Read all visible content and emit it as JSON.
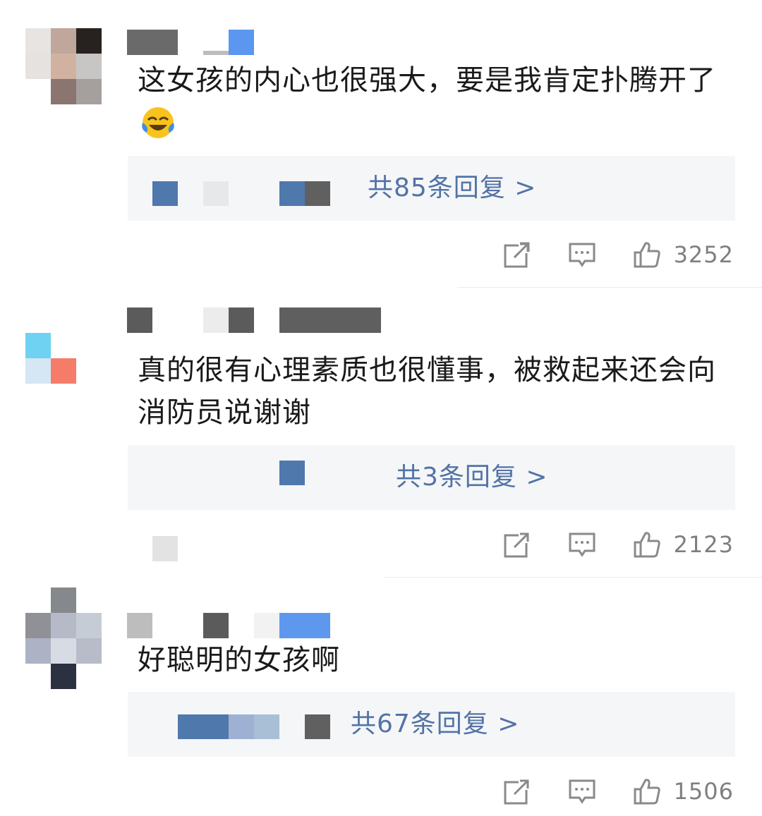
{
  "comments": [
    {
      "text": "这女孩的内心也很强大，要是我肯定扑腾开了",
      "emoji": "tears-of-joy-emoji",
      "reply_link": "共85条回复 >",
      "like_count": "3252"
    },
    {
      "text": "真的很有心理素质也很懂事，被救起来还会向消防员说谢谢",
      "reply_link": "共3条回复 >",
      "like_count": "2123"
    },
    {
      "text": "好聪明的女孩啊",
      "reply_link": "共67条回复 >",
      "like_count": "1506"
    }
  ],
  "colors": {
    "reply_link": "#5273a6",
    "text": "#1a1a1a",
    "icon": "#8a8a8a",
    "reply_bg": "#f5f6f8"
  },
  "icons": [
    "share-icon",
    "comment-icon",
    "like-icon"
  ]
}
